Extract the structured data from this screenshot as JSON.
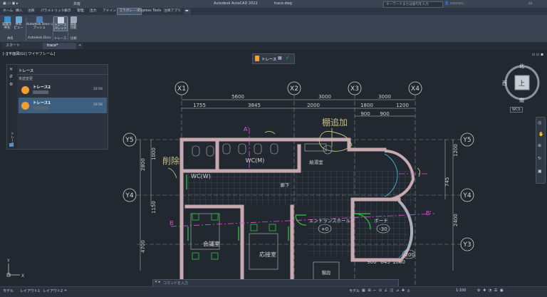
{
  "titlebar": {
    "share_label": "共有",
    "app_title": "Autodesk AutoCAD 2022",
    "file_name": "trace.dwg",
    "search_placeholder": "キーワードまたは語句を入力"
  },
  "menu_tabs": [
    "ホーム",
    "挿入",
    "注釈",
    "パラメトリック",
    "表示",
    "管理",
    "出力",
    "アドイン",
    "コラボレート",
    "Express Tools",
    "注目アプリ"
  ],
  "active_menu_tab": "コラボレート",
  "ribbon": {
    "buttons": [
      {
        "label1": "図面を",
        "label2": "共有"
      },
      {
        "label1": "共有",
        "label2": "ビュー"
      },
      {
        "label1": "Autodesk Docs に",
        "label2": "プッシュ"
      },
      {
        "label1": "トレース",
        "label2": "パレット"
      },
      {
        "label1": "図面",
        "label2": "比較"
      }
    ],
    "groups": [
      "共有",
      "Autodesk Docs",
      "トレース",
      "比較"
    ]
  },
  "doc_tabs": [
    "スタート",
    "trace*"
  ],
  "viewport": {
    "label": "[-][平面図(G)] ワイヤフレーム]"
  },
  "trace_toolbar": {
    "label": "トレース"
  },
  "trace_palette": {
    "title": "トレース",
    "subtitle": "未読変更",
    "side_label": "トレース",
    "items": [
      {
        "name": "トレース2",
        "time": "10:56"
      },
      {
        "name": "トレース1",
        "time": "10:56"
      }
    ]
  },
  "viewcube": {
    "north": "北",
    "south": "南",
    "west": "西",
    "top": "上",
    "wcs": "WCS"
  },
  "drawing": {
    "grid_labels": [
      "X1",
      "X2",
      "X3",
      "X4",
      "Y5",
      "Y4",
      "Y3"
    ],
    "dims_top": [
      "5600",
      "3000",
      "3000"
    ],
    "dims_second": [
      "1755",
      "3845",
      "2000",
      "1800",
      "1200"
    ],
    "dims_third": [
      "900",
      "900"
    ],
    "dims_left": [
      "2800",
      "4700",
      "1150",
      "1000"
    ],
    "dims_right": [
      "1200",
      "745",
      "2400"
    ],
    "dims_bottom": [
      "900",
      "845",
      "1000"
    ],
    "rooms": [
      "WC(M)",
      "WC(W)",
      "給湯室",
      "廊下",
      "エントランスホール",
      "ポーチ",
      "会議室",
      "応接室",
      "階段"
    ],
    "annotations": [
      "棚追加",
      "削除"
    ],
    "level_marks": [
      "+0",
      "-30",
      "-200"
    ],
    "section_marks": [
      "A'",
      "B'",
      "B"
    ]
  },
  "command_line": {
    "placeholder": "コマンドを入力"
  },
  "status_bar": {
    "tabs": [
      "モデル",
      "レイアウト1",
      "レイアウト2"
    ],
    "model_label": "モデル",
    "scale": "1:100"
  },
  "colors": {
    "wall": "#c9a9b0",
    "dimension": "#d8d8d8",
    "annotation": "#c8c080",
    "section": "#e050e0",
    "door": "#34c840",
    "accent_cyan": "#40c8e8",
    "trace_orange": "#f0a030"
  }
}
